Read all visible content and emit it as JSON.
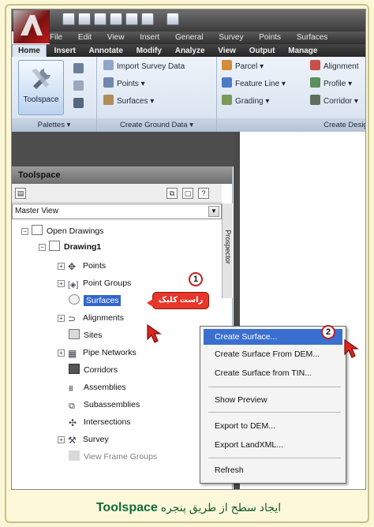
{
  "app": {
    "menu": [
      "File",
      "Edit",
      "View",
      "Insert",
      "General",
      "Survey",
      "Points",
      "Surfaces"
    ],
    "ribbon_tabs": [
      "Home",
      "Insert",
      "Annotate",
      "Modify",
      "Analyze",
      "View",
      "Output",
      "Manage"
    ],
    "active_tab": "Home"
  },
  "ribbon": {
    "palettes": {
      "toolspace_label": "Toolspace",
      "footer": "Palettes"
    },
    "ground": {
      "items": [
        "Import Survey Data",
        "Points",
        "Surfaces"
      ],
      "footer": "Create Ground Data"
    },
    "design": {
      "items": [
        "Parcel",
        "Feature Line",
        "Grading",
        "Alignment",
        "Profile",
        "Corridor"
      ],
      "footer": "Create Design"
    }
  },
  "toolspace": {
    "title": "Toolspace",
    "view_select": "Master View",
    "side_tab": "Prospector",
    "tree": {
      "root": "Open Drawings",
      "drawing": "Drawing1",
      "items": [
        "Points",
        "Point Groups",
        "Surfaces",
        "Alignments",
        "Sites",
        "Pipe Networks",
        "Corridors",
        "Assemblies",
        "Subassemblies",
        "Intersections",
        "Survey",
        "View Frame Groups"
      ]
    }
  },
  "context_menu": {
    "items": [
      "Create Surface...",
      "Create Surface From DEM...",
      "Create Surface from TIN...",
      "Show Preview",
      "Export to DEM...",
      "Export LandXML...",
      "Refresh"
    ]
  },
  "callouts": {
    "one": "1",
    "two": "2",
    "right_click": "راست کلیک"
  },
  "caption": {
    "before": "ایجاد سطح از طریق پنجره",
    "keyword": "Toolspace"
  },
  "colors": {
    "selection": "#3366cc",
    "menu_highlight": "#3a6fd0",
    "callout_red": "#e8362a",
    "caption_green": "#145c2f"
  }
}
